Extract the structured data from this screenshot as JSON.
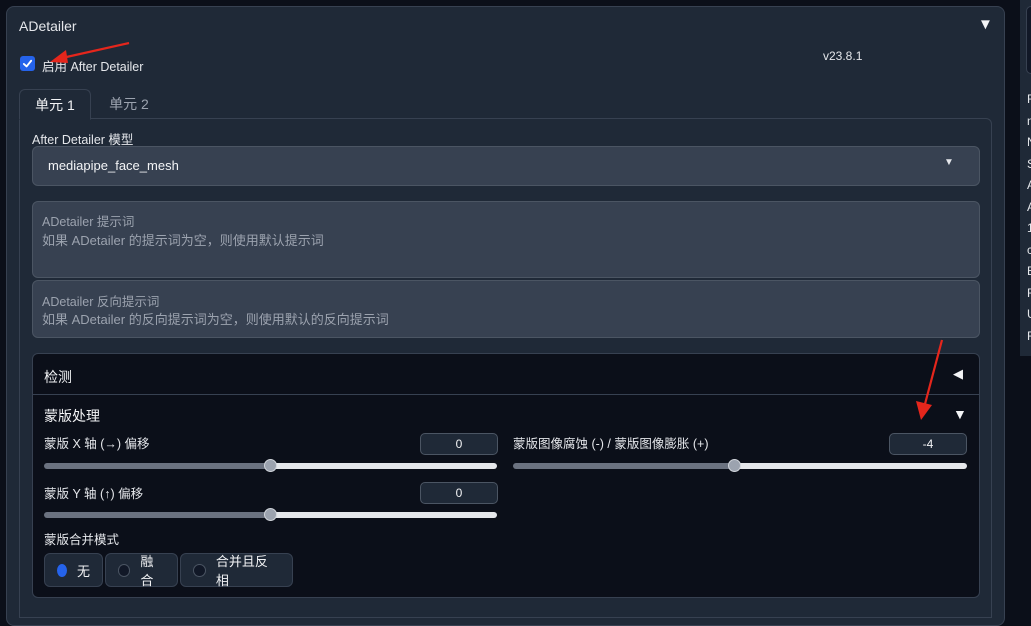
{
  "panel": {
    "title": "ADetailer",
    "version": "v23.8.1"
  },
  "enable": {
    "label": "启用 After Detailer",
    "checked": true
  },
  "tabs": [
    {
      "label": "单元 1",
      "active": true
    },
    {
      "label": "单元 2",
      "active": false
    }
  ],
  "model": {
    "label": "After Detailer 模型",
    "value": "mediapipe_face_mesh"
  },
  "prompt": {
    "label": "ADetailer 提示词",
    "placeholder": "如果 ADetailer 的提示词为空，则使用默认提示词"
  },
  "negative_prompt": {
    "label": "ADetailer 反向提示词",
    "placeholder": "如果 ADetailer 的反向提示词为空，则使用默认的反向提示词"
  },
  "detection": {
    "title": "检测"
  },
  "mask": {
    "title": "蒙版处理",
    "x_offset": {
      "label": "蒙版 X 轴 (→) 偏移",
      "value": "0",
      "fraction": 0.5
    },
    "y_offset": {
      "label": "蒙版 Y 轴 (↑) 偏移",
      "value": "0",
      "fraction": 0.5
    },
    "erode_dilate": {
      "label": "蒙版图像腐蚀 (-) / 蒙版图像膨胀 (+)",
      "value": "-4",
      "fraction": 0.49
    },
    "merge_mode": {
      "label": "蒙版合并模式",
      "options": [
        "无",
        "融合",
        "合并且反相"
      ],
      "selected": "无"
    }
  },
  "right_panel": {
    "letters": [
      "F",
      "n",
      "N",
      "S",
      "A",
      "A",
      "1",
      "c",
      "E",
      "F",
      "U",
      "F"
    ]
  },
  "colors": {
    "accent": "#2563eb",
    "panel": "#1f2937",
    "input": "#374151",
    "background": "#0b0f19"
  },
  "icons": {
    "collapse": "triangle-down-icon",
    "expand": "triangle-left-icon",
    "check": "check-icon",
    "dropdown": "caret-down-icon"
  }
}
